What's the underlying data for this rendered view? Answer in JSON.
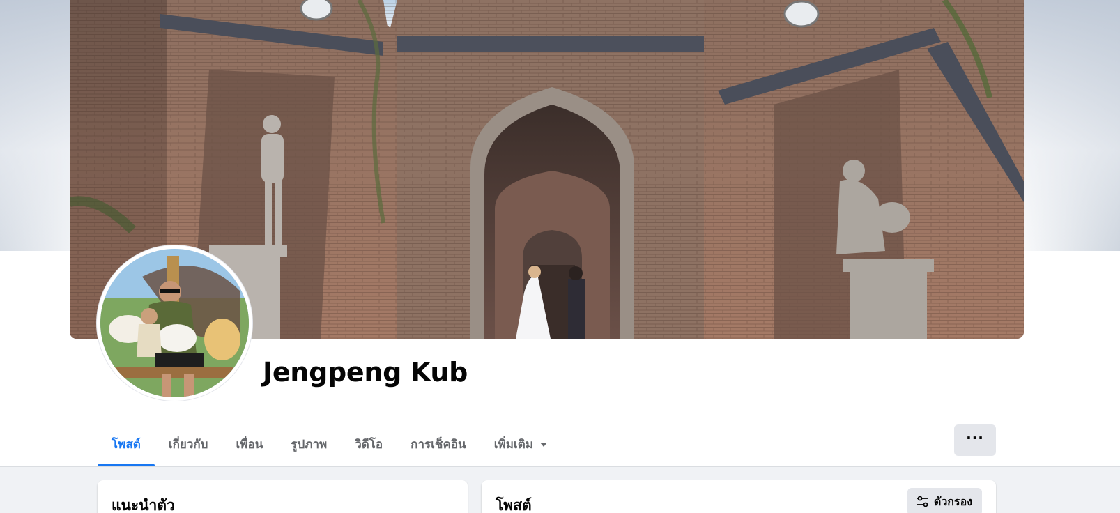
{
  "profile": {
    "name": "Jengpeng Kub"
  },
  "tabs": [
    {
      "label": "โพสต์",
      "active": true
    },
    {
      "label": "เกี่ยวกับ",
      "active": false
    },
    {
      "label": "เพื่อน",
      "active": false
    },
    {
      "label": "รูปภาพ",
      "active": false
    },
    {
      "label": "วิดีโอ",
      "active": false
    },
    {
      "label": "การเช็คอิน",
      "active": false
    },
    {
      "label": "เพิ่มเติม",
      "active": false
    }
  ],
  "more_button": {
    "label": "···",
    "icon": "ellipsis-icon"
  },
  "intro_card": {
    "title": "แนะนำตัว"
  },
  "posts_card": {
    "title": "โพสต์",
    "filter_button": {
      "label": "ตัวกรอง",
      "icon": "sliders-icon"
    }
  },
  "colors": {
    "accent": "#1877f2",
    "text_primary": "#050505",
    "text_secondary": "#65676b",
    "button_bg": "#e4e6eb",
    "feed_bg": "#f0f2f5"
  }
}
